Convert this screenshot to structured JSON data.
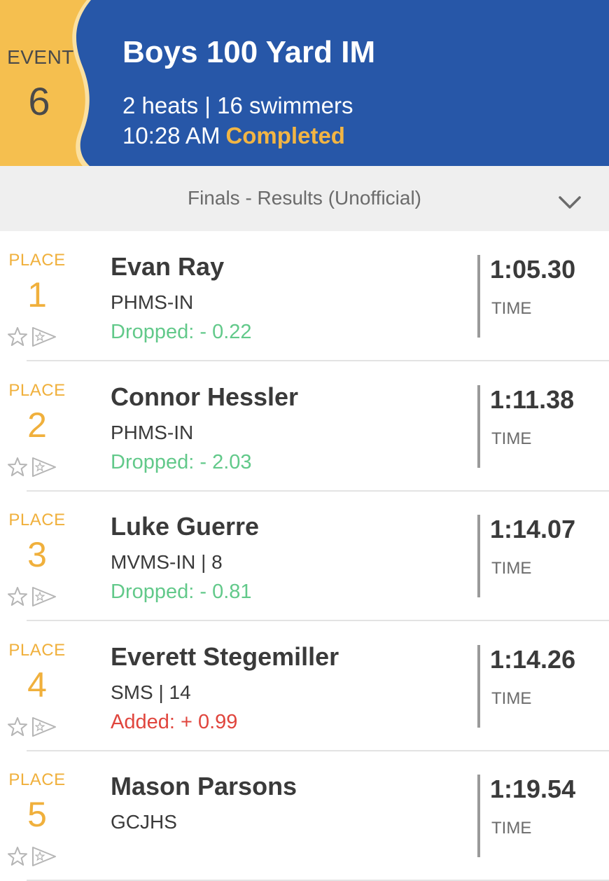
{
  "event": {
    "label": "EVENT",
    "number": "6",
    "title": "Boys 100 Yard IM",
    "meta": "2 heats | 16 swimmers",
    "time": "10:28 AM",
    "status": "Completed",
    "colors": {
      "header": "#2757a8",
      "tab": "#f5bf4f",
      "status": "#f2b544"
    }
  },
  "results_bar": {
    "title": "Finals - Results (Unofficial)",
    "expand_icon": "chevron-down-icon"
  },
  "results": [
    {
      "place_label": "PLACE",
      "place": "1",
      "name": "Evan Ray",
      "team": "PHMS-IN",
      "delta": "Dropped: - 0.22",
      "delta_type": "dropped",
      "time": "1:05.30",
      "time_label": "TIME"
    },
    {
      "place_label": "PLACE",
      "place": "2",
      "name": "Connor Hessler",
      "team": "PHMS-IN",
      "delta": "Dropped: - 2.03",
      "delta_type": "dropped",
      "time": "1:11.38",
      "time_label": "TIME"
    },
    {
      "place_label": "PLACE",
      "place": "3",
      "name": "Luke Guerre",
      "team": "MVMS-IN | 8",
      "delta": "Dropped: - 0.81",
      "delta_type": "dropped",
      "time": "1:14.07",
      "time_label": "TIME"
    },
    {
      "place_label": "PLACE",
      "place": "4",
      "name": "Everett Stegemiller",
      "team": "SMS | 14",
      "delta": "Added: + 0.99",
      "delta_type": "added",
      "time": "1:14.26",
      "time_label": "TIME"
    },
    {
      "place_label": "PLACE",
      "place": "5",
      "name": "Mason Parsons",
      "team": "GCJHS",
      "delta": "",
      "delta_type": "dropped",
      "time": "1:19.54",
      "time_label": "TIME"
    }
  ],
  "icons": {
    "favorite": "star-icon",
    "flag": "flag-star-icon"
  }
}
